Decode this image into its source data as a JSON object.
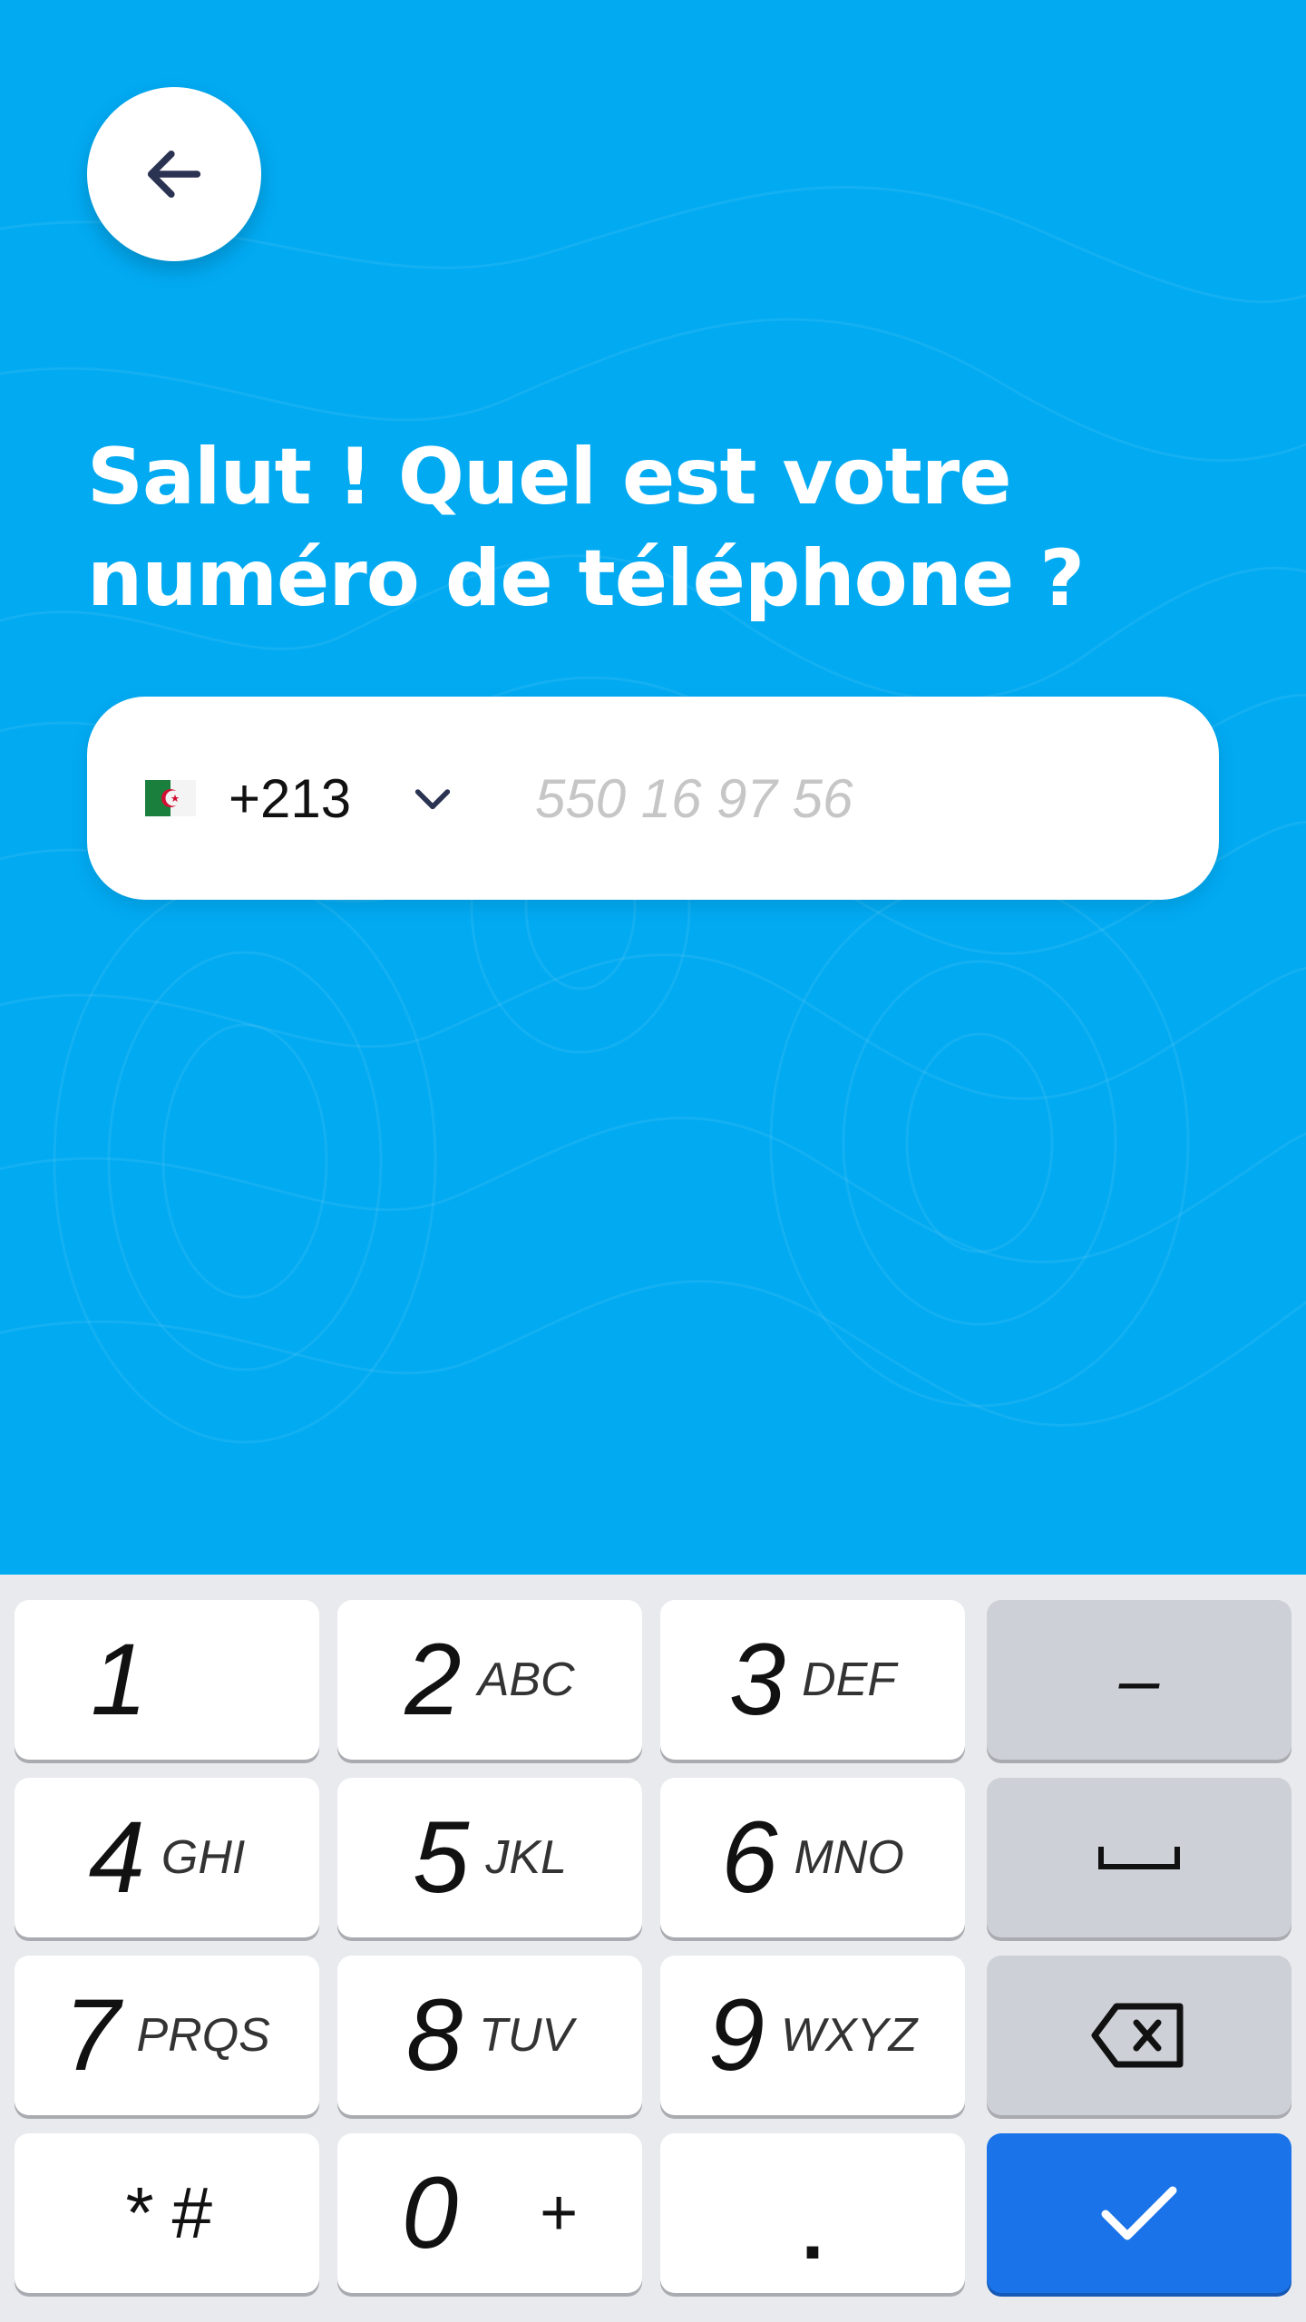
{
  "header": {
    "back_icon": "arrow-left-icon"
  },
  "headline": "Salut ! Quel est votre numéro de téléphone ?",
  "phone": {
    "country_flag": "algeria-flag-icon",
    "dial_code": "+213",
    "dropdown_icon": "chevron-down-icon",
    "placeholder": "550 16 97 56",
    "value": ""
  },
  "keyboard": {
    "keys": [
      {
        "digit": "1",
        "letters": ""
      },
      {
        "digit": "2",
        "letters": "ABC"
      },
      {
        "digit": "3",
        "letters": "DEF"
      },
      {
        "digit": "4",
        "letters": "GHI"
      },
      {
        "digit": "5",
        "letters": "JKL"
      },
      {
        "digit": "6",
        "letters": "MNO"
      },
      {
        "digit": "7",
        "letters": "PRQS"
      },
      {
        "digit": "8",
        "letters": "TUV"
      },
      {
        "digit": "9",
        "letters": "WXYZ"
      },
      {
        "digit": "0",
        "letters": "+"
      }
    ],
    "symbols_label": "* #",
    "dot_label": ".",
    "minus_label": "–",
    "space_icon": "space-bar-icon",
    "backspace_icon": "backspace-icon",
    "confirm_icon": "checkmark-icon"
  },
  "colors": {
    "background": "#02aaf2",
    "confirm_key": "#1a73e8",
    "icon_dark": "#2b3352"
  }
}
